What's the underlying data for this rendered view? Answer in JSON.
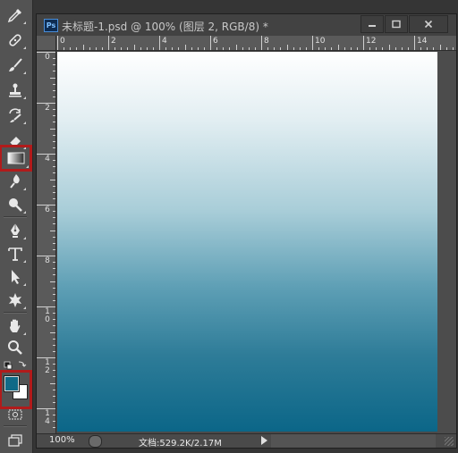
{
  "document": {
    "app_badge": "Ps",
    "title": "未标题-1.psd @ 100% (图层 2, RGB/8) *",
    "ruler_top_labels": [
      "0",
      "2",
      "4",
      "6",
      "8",
      "10",
      "12",
      "14"
    ],
    "ruler_left_labels": [
      "0",
      "2",
      "4",
      "6",
      "8",
      "10",
      "12",
      "14"
    ],
    "zoom": "100%",
    "doc_info": "文档:529.2K/2.17M"
  },
  "colors": {
    "foreground": "#106a87",
    "background": "#ffffff",
    "gradient_top": "#ffffff",
    "gradient_bottom": "#0b6688",
    "highlight": "#b11b1b"
  },
  "tools": [
    {
      "name": "eyedropper-icon"
    },
    {
      "name": "spot-healing-brush-icon"
    },
    {
      "name": "brush-icon"
    },
    {
      "name": "clone-stamp-icon"
    },
    {
      "name": "history-brush-icon"
    },
    {
      "name": "eraser-icon"
    },
    {
      "name": "gradient-icon",
      "selected": true
    },
    {
      "name": "blur-icon"
    },
    {
      "name": "dodge-icon"
    },
    {
      "name": "pen-icon"
    },
    {
      "name": "horizontal-type-icon"
    },
    {
      "name": "path-selection-icon"
    },
    {
      "name": "custom-shape-icon"
    },
    {
      "name": "hand-icon"
    },
    {
      "name": "zoom-icon"
    },
    {
      "name": "quick-mask-icon"
    },
    {
      "name": "screen-mode-icon"
    }
  ]
}
